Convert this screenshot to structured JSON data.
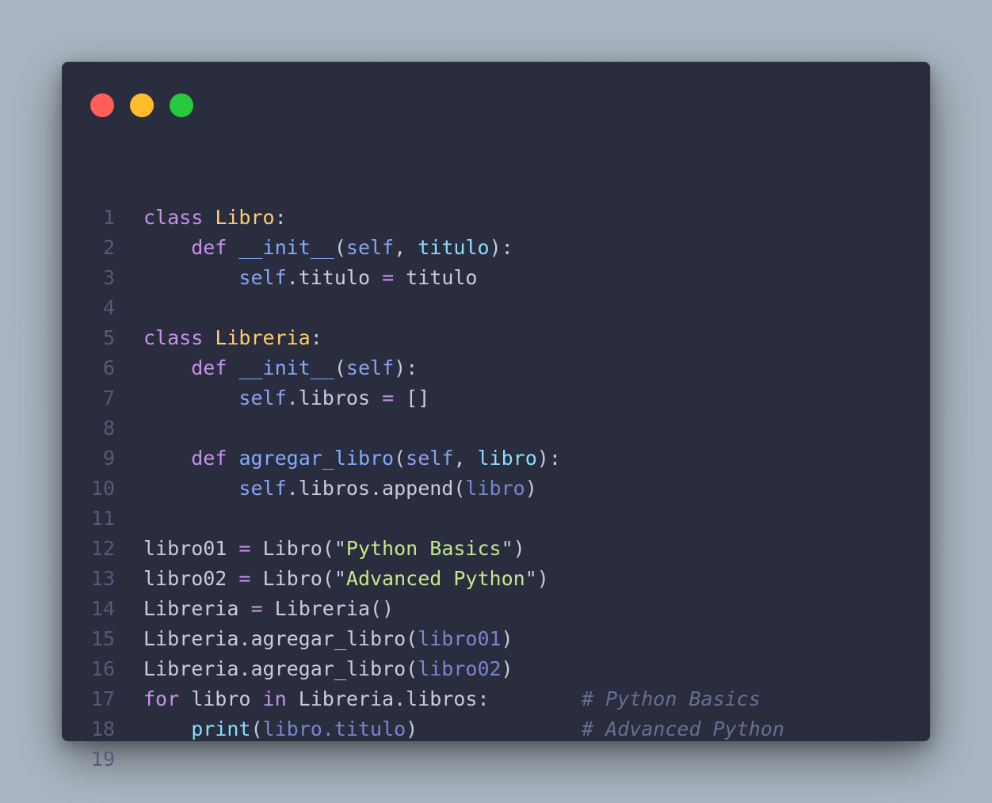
{
  "window": {
    "controls": [
      "close",
      "minimize",
      "maximize"
    ],
    "colors": {
      "background": "#292d3e",
      "close": "#ff5f56",
      "minimize": "#ffbd2e",
      "maximize": "#27c93f"
    }
  },
  "code": {
    "language": "python",
    "lines": [
      {
        "n": "1",
        "tokens": [
          [
            "t-kw",
            "class"
          ],
          [
            "t-punc",
            " "
          ],
          [
            "t-cls",
            "Libro"
          ],
          [
            "t-punc",
            ":"
          ]
        ],
        "comment": ""
      },
      {
        "n": "2",
        "tokens": [
          [
            "t-punc",
            "    "
          ],
          [
            "t-kw",
            "def"
          ],
          [
            "t-punc",
            " "
          ],
          [
            "t-fn",
            "__init__"
          ],
          [
            "t-punc",
            "("
          ],
          [
            "t-self",
            "self"
          ],
          [
            "t-punc",
            ", "
          ],
          [
            "t-param",
            "titulo"
          ],
          [
            "t-punc",
            "):"
          ]
        ],
        "comment": ""
      },
      {
        "n": "3",
        "tokens": [
          [
            "t-punc",
            "        "
          ],
          [
            "t-self",
            "self"
          ],
          [
            "t-punc",
            ".titulo "
          ],
          [
            "t-op",
            "="
          ],
          [
            "t-punc",
            " titulo"
          ]
        ],
        "comment": ""
      },
      {
        "n": "4",
        "tokens": [],
        "comment": ""
      },
      {
        "n": "5",
        "tokens": [
          [
            "t-kw",
            "class"
          ],
          [
            "t-punc",
            " "
          ],
          [
            "t-cls",
            "Libreria"
          ],
          [
            "t-punc",
            ":"
          ]
        ],
        "comment": ""
      },
      {
        "n": "6",
        "tokens": [
          [
            "t-punc",
            "    "
          ],
          [
            "t-kw",
            "def"
          ],
          [
            "t-punc",
            " "
          ],
          [
            "t-fn",
            "__init__"
          ],
          [
            "t-punc",
            "("
          ],
          [
            "t-self",
            "self"
          ],
          [
            "t-punc",
            "):"
          ]
        ],
        "comment": ""
      },
      {
        "n": "7",
        "tokens": [
          [
            "t-punc",
            "        "
          ],
          [
            "t-self",
            "self"
          ],
          [
            "t-punc",
            ".libros "
          ],
          [
            "t-op",
            "="
          ],
          [
            "t-punc",
            " []"
          ]
        ],
        "comment": ""
      },
      {
        "n": "8",
        "tokens": [],
        "comment": ""
      },
      {
        "n": "9",
        "tokens": [
          [
            "t-punc",
            "    "
          ],
          [
            "t-kw",
            "def"
          ],
          [
            "t-punc",
            " "
          ],
          [
            "t-fn",
            "agregar_libro"
          ],
          [
            "t-punc",
            "("
          ],
          [
            "t-self",
            "self"
          ],
          [
            "t-punc",
            ", "
          ],
          [
            "t-param",
            "libro"
          ],
          [
            "t-punc",
            "):"
          ]
        ],
        "comment": ""
      },
      {
        "n": "10",
        "tokens": [
          [
            "t-punc",
            "        "
          ],
          [
            "t-self",
            "self"
          ],
          [
            "t-punc",
            ".libros.append("
          ],
          [
            "t-arg",
            "libro"
          ],
          [
            "t-punc",
            ")"
          ]
        ],
        "comment": ""
      },
      {
        "n": "11",
        "tokens": [],
        "comment": ""
      },
      {
        "n": "12",
        "tokens": [
          [
            "t-var",
            "libro01"
          ],
          [
            "t-punc",
            " "
          ],
          [
            "t-op",
            "="
          ],
          [
            "t-punc",
            " Libro(\""
          ],
          [
            "t-str",
            "Python Basics"
          ],
          [
            "t-punc",
            "\")"
          ]
        ],
        "comment": ""
      },
      {
        "n": "13",
        "tokens": [
          [
            "t-var",
            "libro02"
          ],
          [
            "t-punc",
            " "
          ],
          [
            "t-op",
            "="
          ],
          [
            "t-punc",
            " Libro(\""
          ],
          [
            "t-str",
            "Advanced Python"
          ],
          [
            "t-punc",
            "\")"
          ]
        ],
        "comment": ""
      },
      {
        "n": "14",
        "tokens": [
          [
            "t-var",
            "Libreria"
          ],
          [
            "t-punc",
            " "
          ],
          [
            "t-op",
            "="
          ],
          [
            "t-punc",
            " Libreria()"
          ]
        ],
        "comment": ""
      },
      {
        "n": "15",
        "tokens": [
          [
            "t-var",
            "Libreria.agregar_libro("
          ],
          [
            "t-arg",
            "libro01"
          ],
          [
            "t-punc",
            ")"
          ]
        ],
        "comment": ""
      },
      {
        "n": "16",
        "tokens": [
          [
            "t-var",
            "Libreria.agregar_libro("
          ],
          [
            "t-arg",
            "libro02"
          ],
          [
            "t-punc",
            ")"
          ]
        ],
        "comment": ""
      },
      {
        "n": "17",
        "tokens": [
          [
            "t-kw",
            "for"
          ],
          [
            "t-punc",
            " libro "
          ],
          [
            "t-kw",
            "in"
          ],
          [
            "t-punc",
            " Libreria.libros:"
          ]
        ],
        "comment": "# Python Basics"
      },
      {
        "n": "18",
        "tokens": [
          [
            "t-punc",
            "    "
          ],
          [
            "t-builtin",
            "print"
          ],
          [
            "t-punc",
            "("
          ],
          [
            "t-arg",
            "libro.titulo"
          ],
          [
            "t-punc",
            ")"
          ]
        ],
        "comment": "# Advanced Python"
      },
      {
        "n": "19",
        "tokens": [],
        "comment": ""
      }
    ]
  }
}
